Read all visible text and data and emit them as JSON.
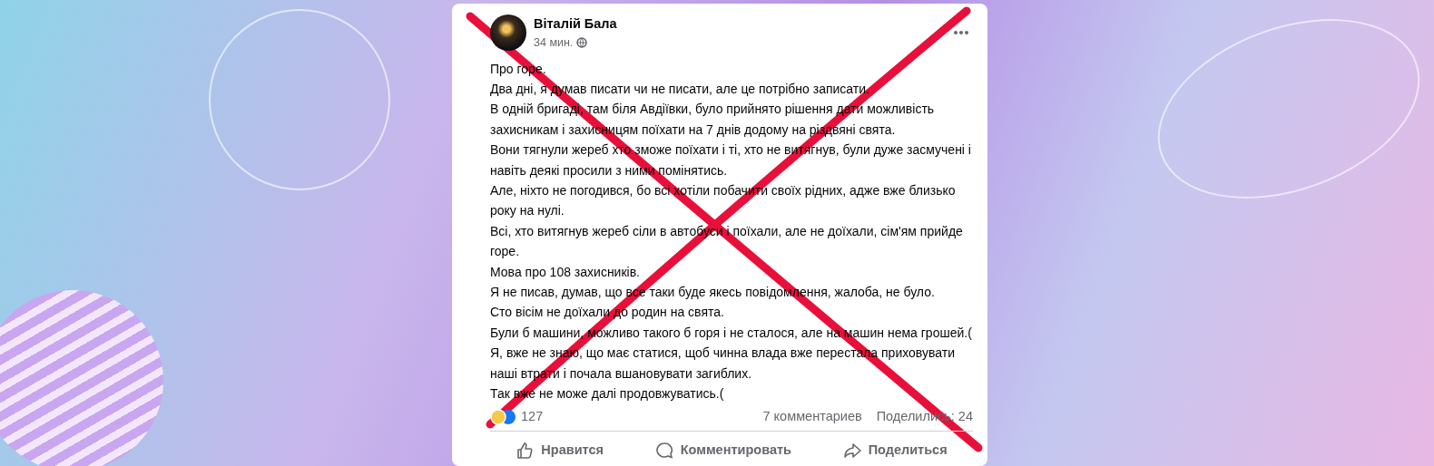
{
  "post": {
    "author": "Віталій Бала",
    "time": "34 мин.",
    "paragraphs": [
      "Про горе.",
      "Два дні, я думав писати чи не писати, але це потрібно записати.",
      "В одній бригаді, там біля Авдіївки, було прийнято рішення дати можливість захисникам і захисницям поїхати на 7 днів додому на різдвяні свята.",
      "Вони тягнули жереб хто зможе поїхати і ті, хто не витягнув, були дуже засмучені і навіть деякі просили з ними помінятись.",
      "Але, ніхто не погодився, бо всі хотіли побачити своїх рідних, адже вже близько року на нулі.",
      "Всі, хто витягнув жереб сіли в автобуси і поїхали, але не доїхали, сім'ям прийде горе.",
      "Мова про 108 захисників.",
      "Я не писав, думав, що все таки буде якесь повідомлення, жалоба, не було.",
      "Сто вісім не доїхали до родин на свята.",
      "Були б машини, можливо такого б горя і не сталося, але на машин нема грошей.(",
      "Я, вже не знаю, що має статися, щоб чинна влада вже  перестала приховувати наші втрати і почала вшановувати загиблих.",
      "Так вже не може далі продовжуватись.("
    ],
    "reactions_count": "127",
    "comments": "7 комментариев",
    "shares": "Поделились: 24",
    "actions": [
      {
        "kind": "like",
        "label": "Нравится"
      },
      {
        "kind": "comment",
        "label": "Комментировать"
      },
      {
        "kind": "share",
        "label": "Поделиться"
      }
    ]
  },
  "crossed_out": true
}
